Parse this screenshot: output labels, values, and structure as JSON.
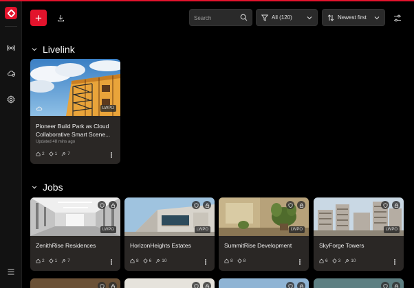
{
  "toolbar": {
    "add_label": "+",
    "search_placeholder": "Search",
    "filter_label": "All (120)",
    "sort_label": "Newest first"
  },
  "livelink": {
    "title": "Livelink",
    "cards": [
      {
        "name": "Pioneer Build Park as Cloud Collaborative Smart Scene...",
        "updated": "Updated 48 mins ago",
        "badge": "LWPO",
        "stats": {
          "a": "2",
          "b": "1",
          "c": "7"
        }
      }
    ]
  },
  "jobs": {
    "title": "Jobs",
    "cards": [
      {
        "name": "ZenithRise Residences",
        "badge": "LWPO",
        "stats": {
          "a": "2",
          "b": "1",
          "c": "7"
        }
      },
      {
        "name": "HorizonHeights Estates",
        "badge": "LWPO",
        "stats": {
          "a": "8",
          "b": "6",
          "c": "10"
        }
      },
      {
        "name": "SummitRise Development",
        "badge": "LWPO",
        "stats": {
          "a": "8",
          "b": "8",
          "c": ""
        }
      },
      {
        "name": "SkyForge Towers",
        "badge": "LWPO",
        "stats": {
          "a": "6",
          "b": "3",
          "c": "10"
        }
      }
    ]
  },
  "colors": {
    "accent": "#e3132c",
    "card": "#2a2725",
    "background": "#000000"
  },
  "icons": [
    "app-logo-icon",
    "antenna-icon",
    "cloud-gear-icon",
    "settings-icon",
    "menu-icon",
    "download-icon",
    "search-icon",
    "filter-icon",
    "sort-icon",
    "tune-icon",
    "chevron-down-icon",
    "shield-icon",
    "lock-icon",
    "home-icon",
    "diamond-icon",
    "pin-icon",
    "more-icon"
  ]
}
